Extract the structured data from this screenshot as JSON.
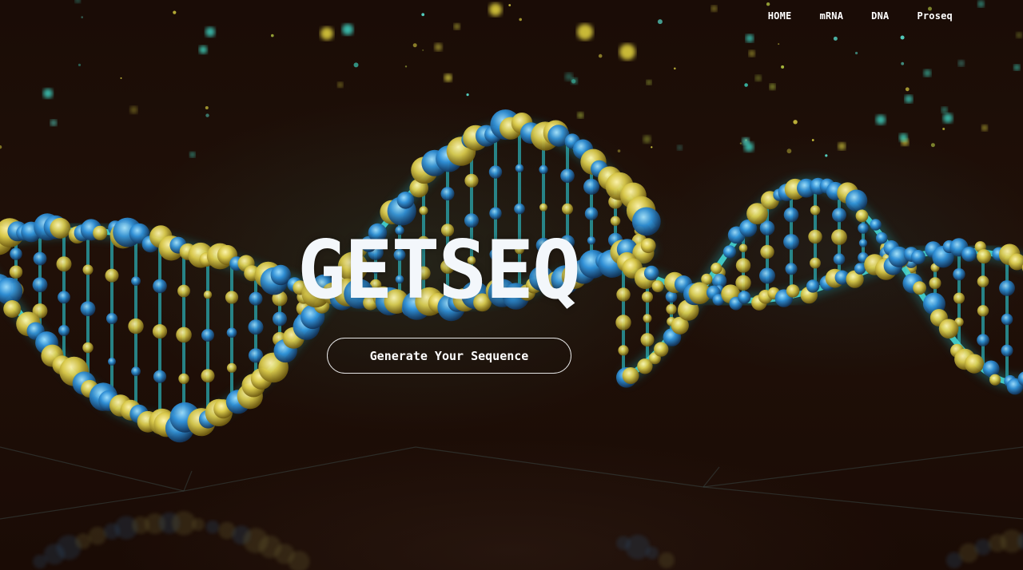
{
  "nav": {
    "items": [
      {
        "label": "HOME"
      },
      {
        "label": "mRNA"
      },
      {
        "label": "DNA"
      },
      {
        "label": "Proseq"
      }
    ]
  },
  "hero": {
    "title": "GETSEQ",
    "cta_label": "Generate Your Sequence",
    "background_image": "dna-double-helix-illustration"
  },
  "colors": {
    "background": "#1c0d07",
    "helix_cyan": "#38c8c8",
    "sphere_yellow": "#d9c94a",
    "sphere_blue": "#2f8fd6",
    "text": "#ffffff"
  }
}
